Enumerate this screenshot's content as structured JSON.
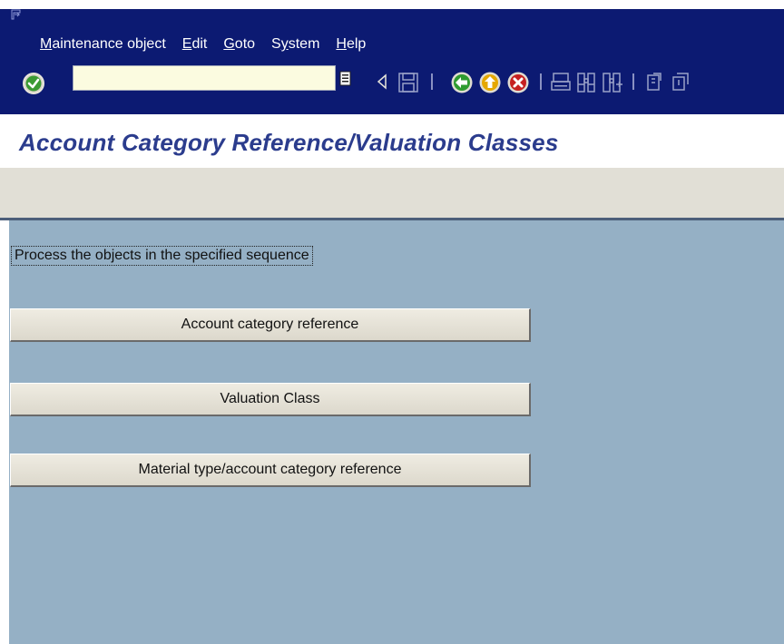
{
  "menubar": {
    "items": [
      {
        "label": "Maintenance object",
        "mnemonic": "M"
      },
      {
        "label": "Edit",
        "mnemonic": "E"
      },
      {
        "label": "Goto",
        "mnemonic": "G"
      },
      {
        "label": "System",
        "mnemonic": "y"
      },
      {
        "label": "Help",
        "mnemonic": "H"
      }
    ]
  },
  "toolbar": {
    "command_field_value": "",
    "icons": [
      "enter-icon",
      "command-history-icon",
      "back-arrow-icon",
      "save-icon",
      "green-back-icon",
      "exit-icon",
      "cancel-icon",
      "print-icon",
      "find-icon",
      "find-next-icon",
      "first-page-icon",
      "previous-page-icon"
    ]
  },
  "title": "Account Category Reference/Valuation Classes",
  "main": {
    "instruction": "Process the objects in the specified sequence",
    "buttons": [
      {
        "label": "Account category reference"
      },
      {
        "label": "Valuation Class"
      },
      {
        "label": "Material type/account category reference"
      }
    ]
  },
  "colors": {
    "menubar_bg": "#0c1a72",
    "title_text": "#2b3c8d",
    "app_strip_bg": "#e1dfd6",
    "main_bg": "#95b0c5",
    "button_bg": "#e8e5db",
    "command_field_bg": "#fbfbe0"
  }
}
